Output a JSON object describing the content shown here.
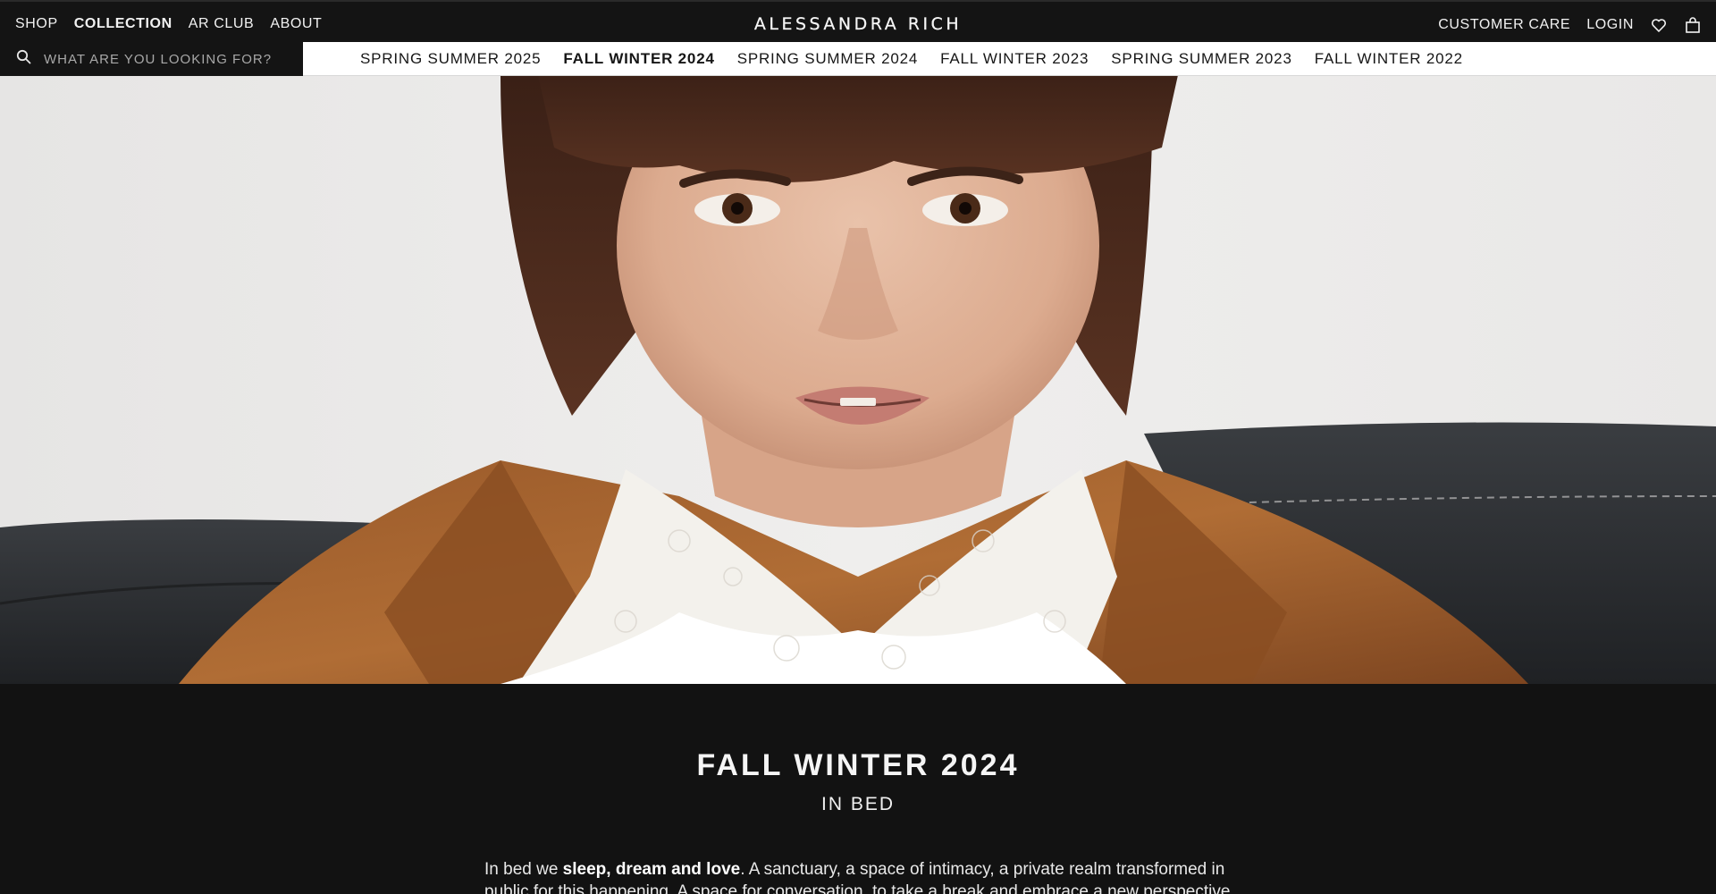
{
  "header": {
    "nav_left": [
      {
        "label": "SHOP",
        "active": false
      },
      {
        "label": "COLLECTION",
        "active": true
      },
      {
        "label": "AR CLUB",
        "active": false
      },
      {
        "label": "ABOUT",
        "active": false
      }
    ],
    "logo": "ALESSANDRA RICH",
    "nav_right": {
      "customer_care": "CUSTOMER CARE",
      "login": "LOGIN",
      "wishlist_icon": "heart-icon",
      "bag_icon": "shopping-bag-icon"
    }
  },
  "search": {
    "placeholder": "WHAT ARE YOU LOOKING FOR?",
    "icon": "search-icon"
  },
  "collections_nav": [
    {
      "label": "SPRING SUMMER 2025",
      "active": false
    },
    {
      "label": "FALL WINTER 2024",
      "active": true
    },
    {
      "label": "SPRING SUMMER 2024",
      "active": false
    },
    {
      "label": "FALL WINTER 2023",
      "active": false
    },
    {
      "label": "SPRING SUMMER 2023",
      "active": false
    },
    {
      "label": "FALL WINTER 2022",
      "active": false
    }
  ],
  "collection": {
    "title": "FALL WINTER 2024",
    "subtitle": "IN BED",
    "intro_before": "In bed we ",
    "intro_bold": "sleep, dream and love",
    "intro_after": ". A sanctuary, a space of intimacy, a private realm transformed in public for this happening. A space for conversation, to take a break and embrace a new perspective. Look at"
  },
  "colors": {
    "header_bg": "#141414",
    "subnav_bg": "#ffffff",
    "content_bg": "#121212",
    "text_light": "#f5f5f5"
  }
}
